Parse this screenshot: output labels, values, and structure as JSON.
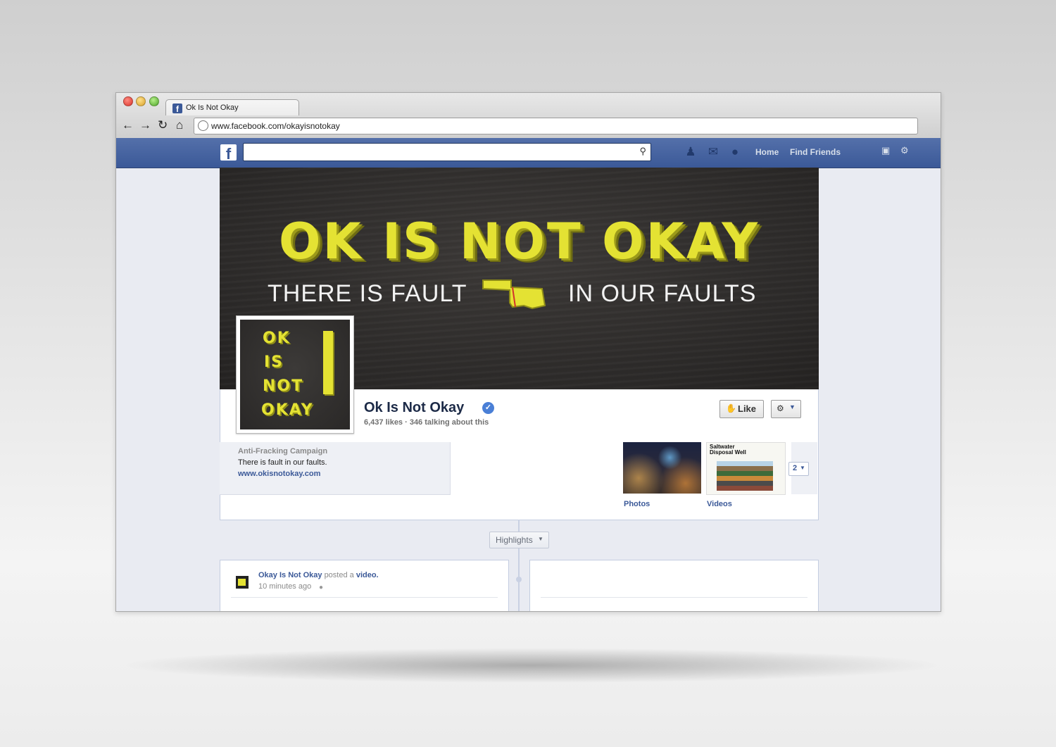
{
  "browser": {
    "tab_title": "Ok Is Not Okay",
    "tab_favicon": "f",
    "url": "www.facebook.com/okayisnotokay",
    "nav_icons": [
      "back-arrow-icon",
      "forward-arrow-icon",
      "reload-icon",
      "home-icon"
    ]
  },
  "fb_bar": {
    "logo": "f",
    "search_value": "",
    "home_label": "Home",
    "find_friends_label": "Find Friends",
    "jewel_icons": [
      "friend-requests-icon",
      "messages-icon",
      "notifications-icon"
    ]
  },
  "cover": {
    "headline": "OK IS NOT OKAY",
    "tagline_left": "THERE IS FAULT",
    "tagline_right": "IN OUR FAULTS"
  },
  "profile_picture": {
    "words": [
      "OK",
      "IS",
      "NOT",
      "OKAY"
    ]
  },
  "page": {
    "name": "Ok Is Not Okay",
    "stats": "6,437 likes · 346 talking about this",
    "like_label": "Like"
  },
  "about": {
    "category": "Anti-Fracking Campaign",
    "description": "There is fault in our faults.",
    "website": "www.okisnotokay.com"
  },
  "apps": {
    "items": [
      {
        "label": "Photos"
      },
      {
        "label": "Videos",
        "thumb_title_1": "Saltwater",
        "thumb_title_2": "Disposal Well"
      }
    ],
    "more_count": "2"
  },
  "timeline": {
    "highlights_label": "Highlights",
    "post": {
      "author": "Okay Is Not Okay",
      "action": "posted a",
      "object": "video.",
      "time": "10 minutes ago"
    }
  },
  "colors": {
    "facebook_blue": "#3b5998",
    "campaign_yellow": "#e4e233",
    "cover_background": "#2c2a29"
  }
}
